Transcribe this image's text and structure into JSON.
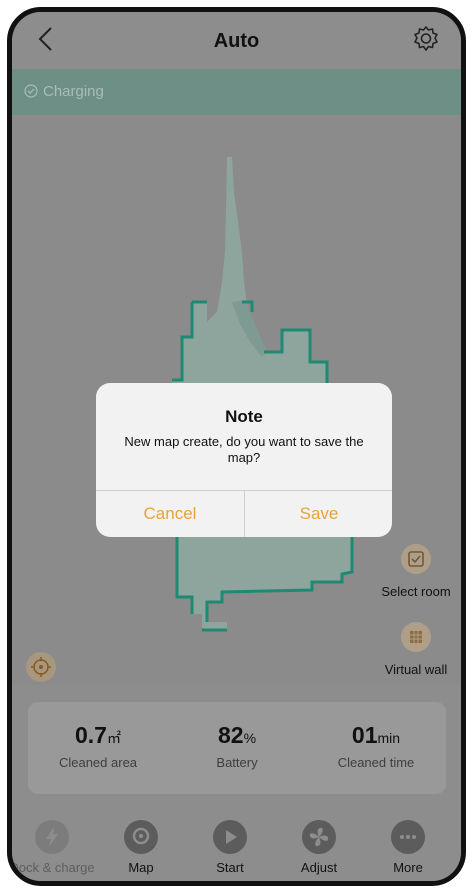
{
  "header": {
    "title": "Auto"
  },
  "status": {
    "text": "Charging"
  },
  "map_controls": {
    "select_room": "Select room",
    "virtual_wall": "Virtual wall"
  },
  "stats": [
    {
      "value": "0.7",
      "unit": "㎡",
      "label": "Cleaned area"
    },
    {
      "value": "82",
      "unit": "%",
      "label": "Battery"
    },
    {
      "value": "01",
      "unit": "min",
      "label": "Cleaned time"
    }
  ],
  "tabs": [
    {
      "label": "Dock & charge",
      "icon": "bolt-icon",
      "enabled": false
    },
    {
      "label": "Map",
      "icon": "map-pin-icon",
      "enabled": true
    },
    {
      "label": "Start",
      "icon": "play-icon",
      "enabled": true
    },
    {
      "label": "Adjust",
      "icon": "fan-icon",
      "enabled": true
    },
    {
      "label": "More",
      "icon": "more-dots-icon",
      "enabled": true
    }
  ],
  "dialog": {
    "title": "Note",
    "message": "New map create, do you want to save the map?",
    "cancel_label": "Cancel",
    "save_label": "Save"
  },
  "colors": {
    "accent": "#e9a23b",
    "map_outline": "#1f8a72",
    "map_fill": "#8ea59e",
    "status_bar": "#6e8f85"
  }
}
